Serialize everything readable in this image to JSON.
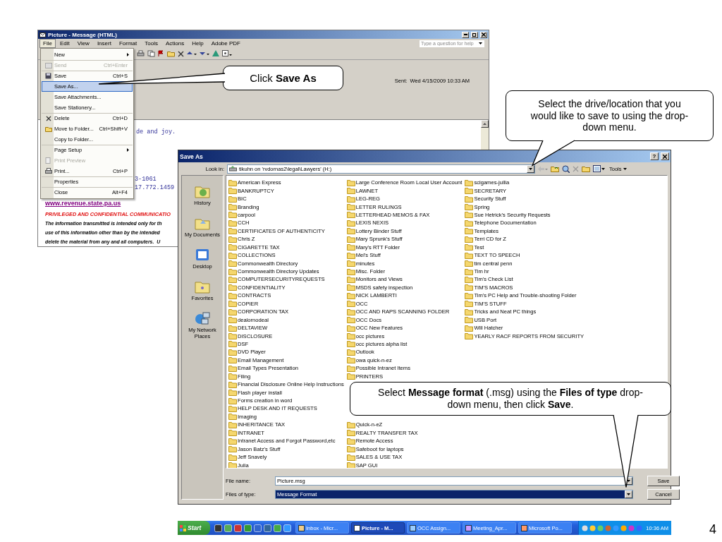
{
  "outlook_window": {
    "title": "Picture - Message (HTML)",
    "menu": [
      {
        "label": "File",
        "selected": true
      },
      {
        "label": "Edit",
        "selected": false
      },
      {
        "label": "View",
        "selected": false
      },
      {
        "label": "Insert",
        "selected": false
      },
      {
        "label": "Format",
        "selected": false
      },
      {
        "label": "Tools",
        "selected": false
      },
      {
        "label": "Actions",
        "selected": false
      },
      {
        "label": "Help",
        "selected": false
      },
      {
        "label": "Adobe PDF",
        "selected": false
      }
    ],
    "help_placeholder": "Type a question for help",
    "sent_label": "Sent:",
    "sent_value": "Wed 4/15/2009 10:33 AM",
    "body_lines": [
      {
        "kind": "greeting",
        "text": "de and joy."
      },
      {
        "kind": "phone",
        "text": "3-1061"
      },
      {
        "kind": "phone",
        "text": "17.772.1459"
      },
      {
        "kind": "link",
        "text": "www.revenue.state.pa.us"
      },
      {
        "kind": "warning",
        "text": "PRIVILEGED AND CONFIDENTIAL COMMUNICATIO"
      },
      {
        "kind": "notice",
        "text": "The information transmitted is intended only for th"
      },
      {
        "kind": "notice",
        "text": "use of this information other than by the intended"
      },
      {
        "kind": "notice",
        "text": "delete the material from any and all computers.  U"
      }
    ]
  },
  "file_menu": [
    {
      "label": "New",
      "submenu": true,
      "disabled": false,
      "selected": false,
      "divider_after": true
    },
    {
      "label": "Send",
      "shortcut": "Ctrl+Enter",
      "disabled": true,
      "selected": false,
      "divider_after": true
    },
    {
      "label": "Save",
      "shortcut": "Ctrl+S",
      "disabled": false,
      "selected": false,
      "divider_after": false
    },
    {
      "label": "Save As...",
      "disabled": false,
      "selected": true,
      "divider_after": false
    },
    {
      "label": "Save Attachments...",
      "disabled": false,
      "selected": false,
      "divider_after": false
    },
    {
      "label": "Save Stationery...",
      "disabled": false,
      "selected": false,
      "divider_after": true
    },
    {
      "label": "Delete",
      "shortcut": "Ctrl+D",
      "disabled": false,
      "selected": false,
      "divider_after": false
    },
    {
      "label": "Move to Folder...",
      "shortcut": "Ctrl+Shift+V",
      "disabled": false,
      "selected": false,
      "divider_after": false
    },
    {
      "label": "Copy to Folder...",
      "disabled": false,
      "selected": false,
      "divider_after": true
    },
    {
      "label": "Page Setup",
      "submenu": true,
      "disabled": false,
      "selected": false,
      "divider_after": false
    },
    {
      "label": "Print Preview",
      "disabled": true,
      "selected": false,
      "divider_after": false
    },
    {
      "label": "Print...",
      "shortcut": "Ctrl+P",
      "disabled": false,
      "selected": false,
      "divider_after": true
    },
    {
      "label": "Properties",
      "disabled": false,
      "selected": false,
      "divider_after": true
    },
    {
      "label": "Close",
      "shortcut": "Alt+F4",
      "disabled": false,
      "selected": false,
      "divider_after": false
    }
  ],
  "save_as_dialog": {
    "title": "Save As",
    "help_button": "?",
    "look_in_label": "Look in:",
    "look_in_value": "tikuhn on 'rvdornas2\\legal\\Lawyers' (H:)",
    "tools_label": "Tools",
    "places": [
      "History",
      "My Documents",
      "Desktop",
      "Favorites",
      "My Network Places"
    ],
    "file_list": {
      "column_1": [
        "American Express",
        "BANKRUPTCY",
        "BIC",
        "Branding",
        "carpool",
        "CCH",
        "CERTIFICATES OF AUTHENTICITY",
        "Chris Z",
        "CIGARETTE TAX",
        "COLLECTIONS",
        "Commonwealth Directory",
        "Commonwealth Directory Updates",
        "COMPUTERSECURITYREQUESTS",
        "CONFIDENTIALITY",
        "CONTRACTS",
        "COPIER",
        "CORPORATION TAX",
        "dealornodeal",
        "DELTAVIEW",
        "DISCLOSURE",
        "DSF",
        "DVD Player",
        "Email Management",
        "Email Types Presentation",
        "Filing",
        "Financial Disclosure Online Help Instructions",
        "Flash player install",
        "Forms creation in word",
        "HELP DESK AND IT REQUESTS",
        "Imaging",
        "INHERITANCE TAX",
        "INTRANET",
        "Intranet Access and Forgot Password,etc",
        "Jason Batz's Stuff",
        "Jeff Snavely",
        "Julia"
      ],
      "column_2": [
        "Large Conference Room Local User Account",
        "LAWNET",
        "LEG-REG",
        "LETTER RULINGS",
        "LETTERHEAD MEMOS & FAX",
        "LEXIS NEXIS",
        "Lottery Binder Stuff",
        "Mary Sprunk's Stuff",
        "Mary's RTT Folder",
        "Mel's Stuff",
        "minutes",
        "Misc. Folder",
        "Monitors and Views",
        "MSDS safety inspection",
        "NICK LAMBERTI",
        "OCC",
        "OCC AND RAPS SCANNING FOLDER",
        "OCC Docs",
        "OCC New Features",
        "occ pictures",
        "occ pictures alpha list",
        "Outlook",
        "owa quick-n-ez",
        "Possible Intranet Items",
        "PRINTERS"
      ],
      "column_2_continued": [
        "Quick-n-eZ",
        "REALTY TRANSFER TAX",
        "Remote Access",
        "Safeboot for laptops",
        "SALES & USE TAX",
        "SAP GUI"
      ],
      "column_3": [
        "scigames-jullia",
        "SECRETARY",
        "Security Stuff",
        "Spring",
        "Sue Hetrick's Security Requests",
        "Telephone Documentation",
        "Templates",
        "Terri CD for Z",
        "Test",
        "TEXT TO SPEECH",
        "tim central penn",
        "Tim hr",
        "Tim's Check List",
        "TIM'S MACROS",
        "Tim's PC Help and Trouble-shooting Folder",
        "TIM'S STUFF",
        "Tricks and Neat PC things",
        "USB Port",
        "Will Hatcher",
        "YEARLY RACF REPORTS FROM SECURITY"
      ]
    },
    "file_name_label": "File name:",
    "file_name_value": "Picture.msg",
    "file_type_label": "Files of type:",
    "file_type": {
      "value": "Message Format",
      "selected": true
    },
    "buttons": [
      "Save",
      "Cancel"
    ]
  },
  "taskbar": {
    "start": "Start",
    "tasks": [
      {
        "label": "Inbox - Micr...",
        "selected": false
      },
      {
        "label": "Picture - M...",
        "selected": true
      },
      {
        "label": "OCC Assign...",
        "selected": false
      },
      {
        "label": "Meeting_Apr...",
        "selected": false
      },
      {
        "label": "Microsoft Po...",
        "selected": false
      }
    ],
    "clock": "10:36 AM"
  },
  "callouts": [
    {
      "text": "Click **Save As**"
    },
    {
      "text": "Select the drive/location that you would like to save to using the drop-down menu."
    },
    {
      "text": "Select **Message format** (.msg) using the **Files of type** drop-down menu, then click **Save**."
    }
  ],
  "page_number": "4"
}
